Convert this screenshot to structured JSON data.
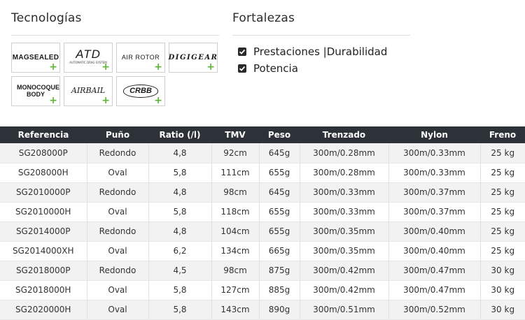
{
  "tecnologias": {
    "title": "Tecnologías",
    "items": [
      {
        "label": "MAGSEALED",
        "icon": "magsealed-logo"
      },
      {
        "label": "ATD",
        "sublabel": "AUTOMATIC DRAG SYSTEM",
        "icon": "atd-logo"
      },
      {
        "label": "AIR ROTOR",
        "icon": "air-rotor-logo"
      },
      {
        "label": "DIGIGEAR",
        "icon": "digigear-logo"
      },
      {
        "label": "MONOCOQUE BODY",
        "icon": "monocoque-body-logo"
      },
      {
        "label": "AIRBAIL",
        "icon": "airbail-logo"
      },
      {
        "label": "CRBB",
        "icon": "crbb-logo"
      }
    ],
    "plus": "+"
  },
  "fortalezas": {
    "title": "Fortalezas",
    "items": [
      {
        "label": "Prestaciones |Durabilidad",
        "checked": true
      },
      {
        "label": "Potencia",
        "checked": true
      }
    ]
  },
  "table": {
    "headers": [
      "Referencia",
      "Puño",
      "Ratio (/l)",
      "TMV",
      "Peso",
      "Trenzado",
      "Nylon",
      "Freno"
    ],
    "rows": [
      [
        "SG208000P",
        "Redondo",
        "4,8",
        "92cm",
        "645g",
        "300m/0.28mm",
        "300m/0.33mm",
        "25 kg"
      ],
      [
        "SG208000H",
        "Oval",
        "5,8",
        "111cm",
        "655g",
        "300m/0.28mm",
        "300m/0.33mm",
        "25 kg"
      ],
      [
        "SG2010000P",
        "Redondo",
        "4,8",
        "98cm",
        "645g",
        "300m/0.33mm",
        "300m/0.37mm",
        "25 kg"
      ],
      [
        "SG2010000H",
        "Oval",
        "5,8",
        "118cm",
        "655g",
        "300m/0.33mm",
        "300m/0.37mm",
        "25 kg"
      ],
      [
        "SG2014000P",
        "Redondo",
        "4,8",
        "104cm",
        "655g",
        "300m/0.35mm",
        "300m/0.40mm",
        "25 kg"
      ],
      [
        "SG2014000XH",
        "Oval",
        "6,2",
        "134cm",
        "665g",
        "300m/0.35mm",
        "300m/0.40mm",
        "25 kg"
      ],
      [
        "SG2018000P",
        "Redondo",
        "4,5",
        "98cm",
        "875g",
        "300m/0.42mm",
        "300m/0.47mm",
        "30 kg"
      ],
      [
        "SG2018000H",
        "Oval",
        "5,8",
        "127cm",
        "885g",
        "300m/0.42mm",
        "300m/0.47mm",
        "30 kg"
      ],
      [
        "SG2020000H",
        "Oval",
        "5,8",
        "143cm",
        "890g",
        "300m/0.51mm",
        "300m/0.52mm",
        "30 kg"
      ]
    ]
  },
  "colors": {
    "plus": "#5cb531",
    "header_bg": "#2d3238",
    "row_alt": "#f2f2f2"
  }
}
